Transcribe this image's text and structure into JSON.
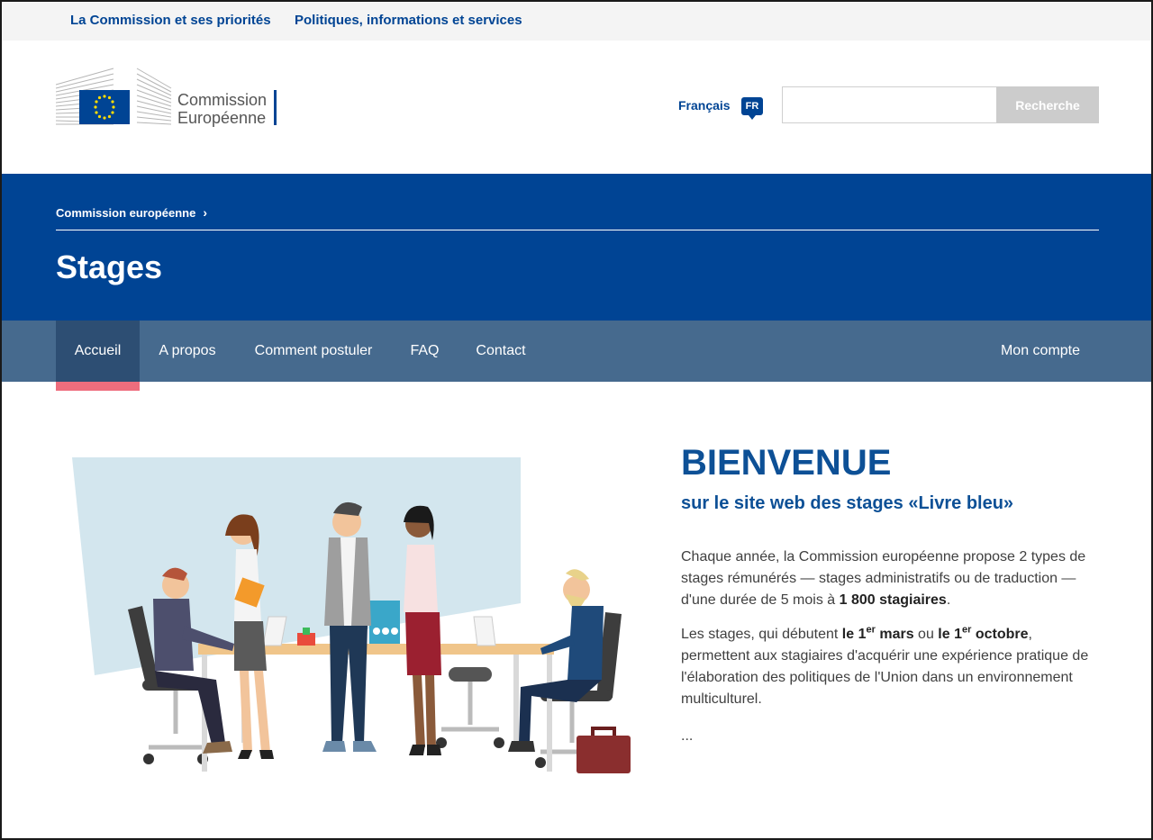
{
  "topbar": {
    "link1": "La Commission et ses priorités",
    "link2": "Politiques, informations et services"
  },
  "logo": {
    "line1": "Commission",
    "line2": "Européenne"
  },
  "language": {
    "label": "Français",
    "code": "FR"
  },
  "search": {
    "value": "",
    "button": "Recherche"
  },
  "breadcrumb": {
    "item": "Commission européenne"
  },
  "page": {
    "title": "Stages"
  },
  "nav": {
    "items": [
      "Accueil",
      "A propos",
      "Comment postuler",
      "FAQ",
      "Contact"
    ],
    "active": "Accueil",
    "account": "Mon compte"
  },
  "welcome": {
    "title": "BIENVENUE",
    "subtitle": "sur le site web des stages «Livre bleu»",
    "p1_a": "Chaque année, la Commission européenne propose 2 types de stages rémunérés — stages administratifs ou de traduction — d'une durée de 5 mois à ",
    "p1_b": "1 800 stagiaires",
    "p1_c": ".",
    "p2_a": "Les stages, qui débutent ",
    "p2_b": "le 1",
    "p2_sup1": "er",
    "p2_c": " mars",
    "p2_d": " ou ",
    "p2_e": "le 1",
    "p2_sup2": "er",
    "p2_f": " octobre",
    "p2_g": ", permettent aux stagiaires d'acquérir une expérience pratique de l'élaboration des politiques de l'Union dans un environnement multiculturel.",
    "ellipsis": "..."
  },
  "colors": {
    "brand_blue": "#004494",
    "nav_blue": "#466a8e",
    "nav_active": "#2d4e73",
    "active_underline": "#ee6d7d"
  }
}
